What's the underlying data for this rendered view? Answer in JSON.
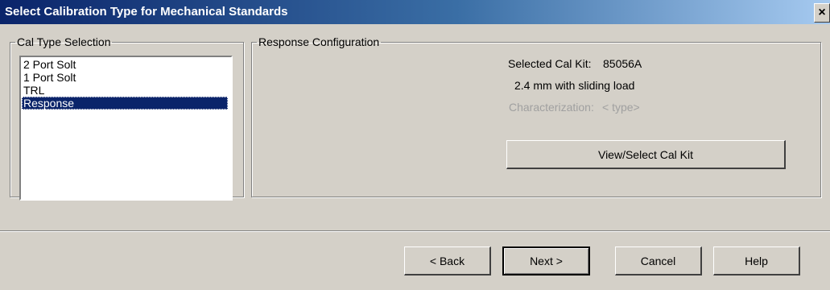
{
  "window": {
    "title": "Select Calibration Type for Mechanical Standards",
    "close_label": "×"
  },
  "cal_type": {
    "legend": "Cal Type Selection",
    "items": [
      "2 Port Solt",
      "1 Port Solt",
      "TRL",
      "Response"
    ],
    "selected": "Response"
  },
  "response_config": {
    "legend": "Response Configuration",
    "selected_kit_label": "Selected Cal Kit:",
    "selected_kit_value": "85056A",
    "kit_description": "2.4 mm with sliding load",
    "characterization_label": "Characterization:",
    "characterization_value": "< type>",
    "view_select_button": "View/Select Cal Kit"
  },
  "footer": {
    "back_label": "< Back",
    "next_label": "Next >",
    "cancel_label": "Cancel",
    "help_label": "Help"
  }
}
